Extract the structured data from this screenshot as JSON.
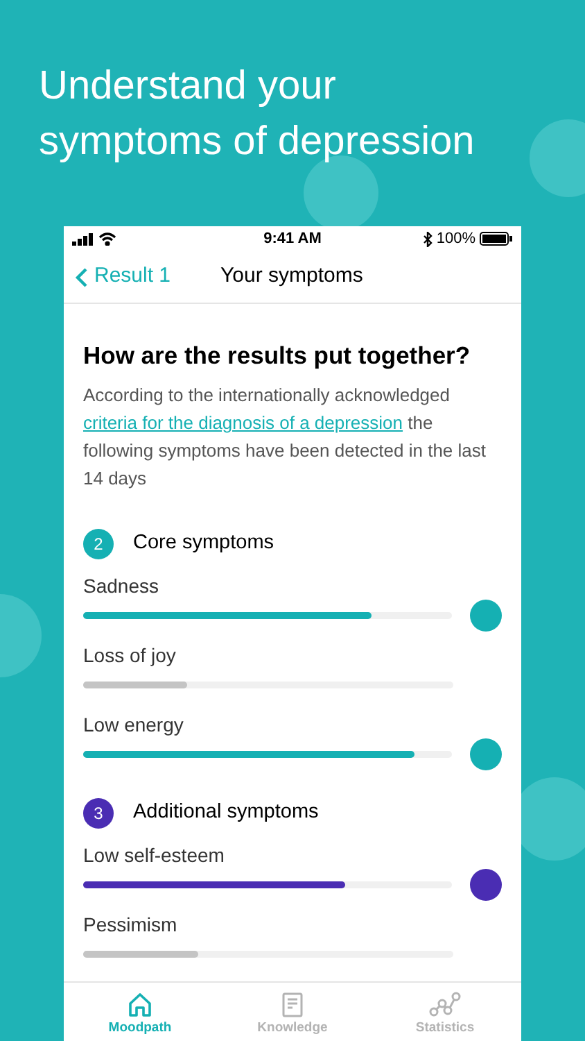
{
  "headline": "Understand your symptoms of depression",
  "status_bar": {
    "time": "9:41 AM",
    "battery": "100%"
  },
  "nav": {
    "back": "Result 1",
    "title": "Your symptoms"
  },
  "heading": "How are the results put together?",
  "intro": {
    "before": "According to the internationally acknowledged",
    "link": "criteria for the diagnosis of a depression",
    "after": "the following symptoms have been detected in the last 14 days"
  },
  "groups": [
    {
      "count": "2",
      "title": "Core symptoms",
      "color": "#15b0b3",
      "symptoms": [
        {
          "name": "Sadness",
          "level": 0.78,
          "detected": true
        },
        {
          "name": "Loss of joy",
          "level": 0.28,
          "detected": false
        },
        {
          "name": "Low energy",
          "level": 0.9,
          "detected": true
        }
      ]
    },
    {
      "count": "3",
      "title": "Additional symptoms",
      "color": "#4a2db3",
      "symptoms": [
        {
          "name": "Low self-esteem",
          "level": 0.71,
          "detected": true
        },
        {
          "name": "Pessimism",
          "level": 0.31,
          "detected": false
        }
      ]
    }
  ],
  "tabs": [
    {
      "label": "Moodpath",
      "kind": "home",
      "selected": true
    },
    {
      "label": "Knowledge",
      "kind": "book",
      "selected": false
    },
    {
      "label": "Statistics",
      "kind": "stats",
      "selected": false
    }
  ]
}
